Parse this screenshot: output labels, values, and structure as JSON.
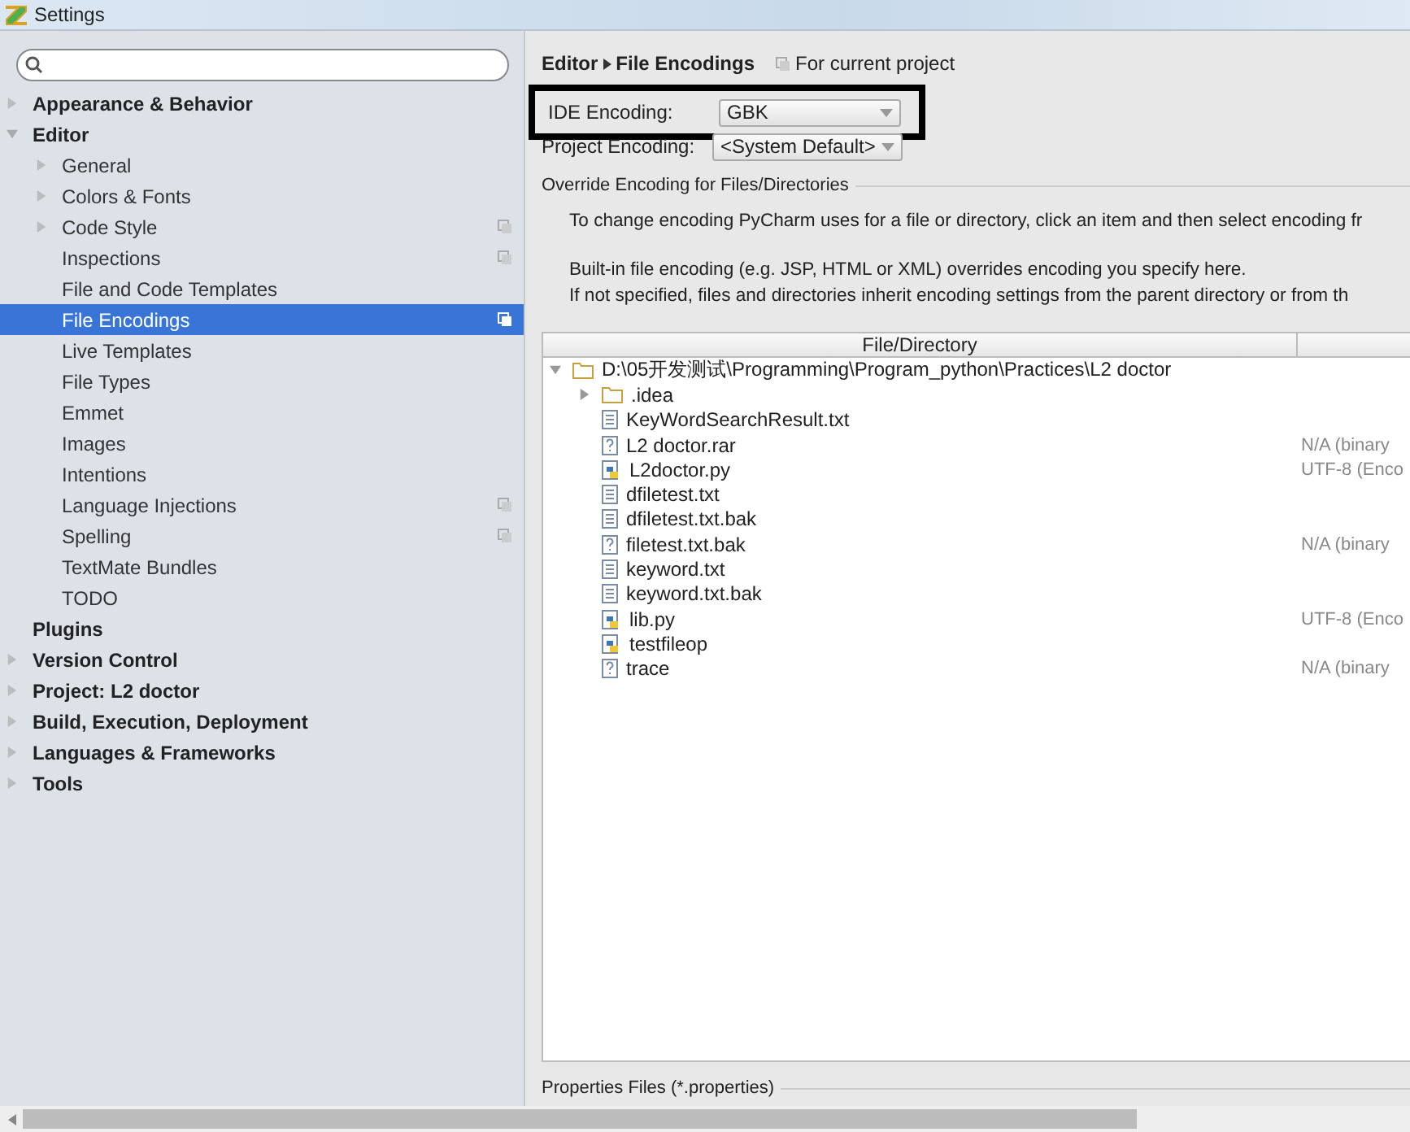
{
  "window": {
    "title": "Settings"
  },
  "sidebar": {
    "items": [
      {
        "label": "Appearance & Behavior",
        "expanded": false,
        "selected": false,
        "project_scoped": false,
        "expandable": true
      },
      {
        "label": "Editor",
        "expanded": true,
        "selected": false,
        "project_scoped": false,
        "children": [
          {
            "label": "General",
            "expanded": false,
            "selected": false,
            "project_scoped": false,
            "expandable": true
          },
          {
            "label": "Colors & Fonts",
            "expanded": false,
            "selected": false,
            "project_scoped": false,
            "expandable": true
          },
          {
            "label": "Code Style",
            "expanded": false,
            "selected": false,
            "project_scoped": true,
            "expandable": true
          },
          {
            "label": "Inspections",
            "selected": false,
            "project_scoped": true
          },
          {
            "label": "File and Code Templates",
            "selected": false,
            "project_scoped": false
          },
          {
            "label": "File Encodings",
            "selected": true,
            "project_scoped": true
          },
          {
            "label": "Live Templates",
            "selected": false,
            "project_scoped": false
          },
          {
            "label": "File Types",
            "selected": false,
            "project_scoped": false
          },
          {
            "label": "Emmet",
            "selected": false,
            "project_scoped": false
          },
          {
            "label": "Images",
            "selected": false,
            "project_scoped": false
          },
          {
            "label": "Intentions",
            "selected": false,
            "project_scoped": false
          },
          {
            "label": "Language Injections",
            "selected": false,
            "project_scoped": true
          },
          {
            "label": "Spelling",
            "selected": false,
            "project_scoped": true
          },
          {
            "label": "TextMate Bundles",
            "selected": false,
            "project_scoped": false
          },
          {
            "label": "TODO",
            "selected": false,
            "project_scoped": false
          }
        ]
      },
      {
        "label": "Plugins",
        "selected": false,
        "project_scoped": false
      },
      {
        "label": "Version Control",
        "expanded": false,
        "selected": false,
        "project_scoped": false,
        "expandable": true
      },
      {
        "label": "Project: L2 doctor",
        "expanded": false,
        "selected": false,
        "project_scoped": false,
        "expandable": true
      },
      {
        "label": "Build, Execution, Deployment",
        "expanded": false,
        "selected": false,
        "project_scoped": false,
        "expandable": true
      },
      {
        "label": "Languages & Frameworks",
        "expanded": false,
        "selected": false,
        "project_scoped": false,
        "expandable": true
      },
      {
        "label": "Tools",
        "expanded": false,
        "selected": false,
        "project_scoped": false,
        "expandable": true
      }
    ]
  },
  "breadcrumb": {
    "parent": "Editor",
    "current": "File Encodings",
    "scope": "For current project"
  },
  "ide_encoding": {
    "label": "IDE Encoding:",
    "value": "GBK",
    "highlighted": true
  },
  "project_encoding": {
    "label": "Project Encoding:",
    "value": "<System Default>"
  },
  "override_section": {
    "title": "Override Encoding for Files/Directories",
    "paragraphs": [
      [
        "To change encoding PyCharm uses for a file or directory, click an item and then select encoding fr"
      ],
      [
        "Built-in file encoding (e.g. JSP, HTML or XML) overrides encoding you specify here.",
        "If not specified, files and directories inherit encoding settings from the parent directory or from th"
      ]
    ]
  },
  "table": {
    "columns": [
      "File/Directory"
    ],
    "rows": [
      {
        "kind": "folder",
        "name": "D:\\05开发测试\\Programming\\Program_python\\Practices\\L2 doctor",
        "expanded": true,
        "children": [
          {
            "kind": "folder",
            "name": ".idea",
            "expanded": false
          },
          {
            "kind": "text",
            "name": "KeyWordSearchResult.txt"
          },
          {
            "kind": "unknown",
            "name": "L2 doctor.rar",
            "encoding": "N/A (binary"
          },
          {
            "kind": "python",
            "name": "L2doctor.py",
            "encoding": "UTF-8 (Enco"
          },
          {
            "kind": "text",
            "name": "dfiletest.txt"
          },
          {
            "kind": "text",
            "name": "dfiletest.txt.bak"
          },
          {
            "kind": "unknown",
            "name": "filetest.txt.bak",
            "encoding": "N/A (binary"
          },
          {
            "kind": "text",
            "name": "keyword.txt"
          },
          {
            "kind": "text",
            "name": "keyword.txt.bak"
          },
          {
            "kind": "python",
            "name": "lib.py",
            "encoding": "UTF-8 (Enco"
          },
          {
            "kind": "python",
            "name": "testfileop"
          },
          {
            "kind": "unknown",
            "name": "trace",
            "encoding": "N/A (binary"
          }
        ]
      }
    ]
  },
  "properties_section": {
    "title": "Properties Files (*.properties)"
  }
}
